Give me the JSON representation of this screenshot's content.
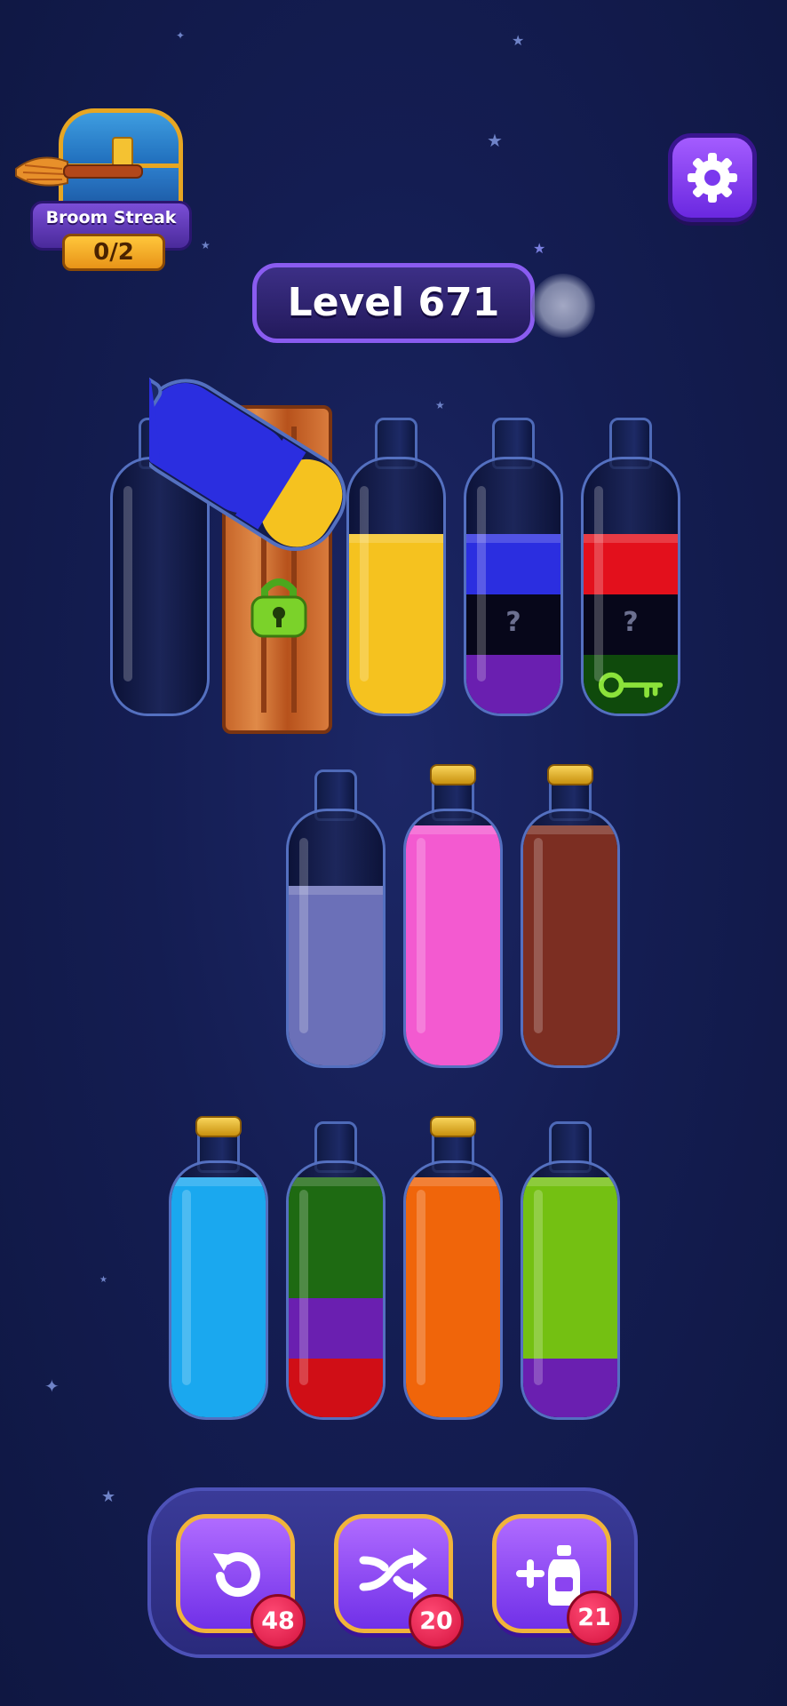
{
  "streak": {
    "title": "Broom Streak",
    "count": "0/2"
  },
  "level": {
    "label": "Level 671"
  },
  "colors": {
    "blue": "#2b2ee0",
    "yellow": "#f5c21f",
    "red": "#e3101c",
    "black": "#07071a",
    "purple": "#6a1fb0",
    "dark_green": "#0f4a0c",
    "lavender": "#6b70b8",
    "pink": "#f35ad0",
    "brown": "#7c2e22",
    "sky": "#1aa8ef",
    "green": "#1e6a12",
    "crimson": "#d00e16",
    "orange": "#f0650a",
    "lime": "#74c012"
  },
  "bottles": [
    {
      "id": "b1",
      "corked": false,
      "layers": []
    },
    {
      "id": "b2",
      "locked": true,
      "lock_icon": "padlock-icon"
    },
    {
      "id": "b3",
      "corked": false,
      "layers": [
        {
          "color": "yellow",
          "units": 3
        }
      ]
    },
    {
      "id": "b4",
      "corked": false,
      "layers": [
        {
          "color": "blue",
          "units": 1
        },
        {
          "color": "black",
          "units": 1,
          "hidden": true,
          "mark": "?"
        },
        {
          "color": "purple",
          "units": 1
        }
      ]
    },
    {
      "id": "b5",
      "corked": false,
      "layers": [
        {
          "color": "red",
          "units": 1
        },
        {
          "color": "black",
          "units": 1,
          "hidden": true,
          "mark": "?"
        },
        {
          "color": "dark_green",
          "units": 1,
          "item": "key-icon"
        }
      ]
    },
    {
      "id": "b6",
      "corked": false,
      "layers": [
        {
          "color": "lavender",
          "units": 3
        }
      ]
    },
    {
      "id": "b7",
      "corked": true,
      "layers": [
        {
          "color": "pink",
          "units": 4
        }
      ]
    },
    {
      "id": "b8",
      "corked": true,
      "layers": [
        {
          "color": "brown",
          "units": 4
        }
      ]
    },
    {
      "id": "b9",
      "corked": true,
      "layers": [
        {
          "color": "sky",
          "units": 4
        }
      ]
    },
    {
      "id": "b10",
      "corked": false,
      "layers": [
        {
          "color": "green",
          "units": 2
        },
        {
          "color": "purple",
          "units": 1
        },
        {
          "color": "crimson",
          "units": 1
        }
      ]
    },
    {
      "id": "b11",
      "corked": true,
      "layers": [
        {
          "color": "orange",
          "units": 4
        }
      ]
    },
    {
      "id": "b12",
      "corked": false,
      "layers": [
        {
          "color": "lime",
          "units": 3
        },
        {
          "color": "purple",
          "units": 1
        }
      ]
    }
  ],
  "pouring_bottle": {
    "layers": [
      {
        "color": "blue",
        "units": 2
      },
      {
        "color": "yellow",
        "units": 1
      }
    ]
  },
  "tools": [
    {
      "id": "undo",
      "icon": "undo-icon",
      "count": "48"
    },
    {
      "id": "shuffle",
      "icon": "shuffle-icon",
      "count": "20"
    },
    {
      "id": "add-bottle",
      "icon": "add-bottle-icon",
      "count": "21"
    }
  ]
}
